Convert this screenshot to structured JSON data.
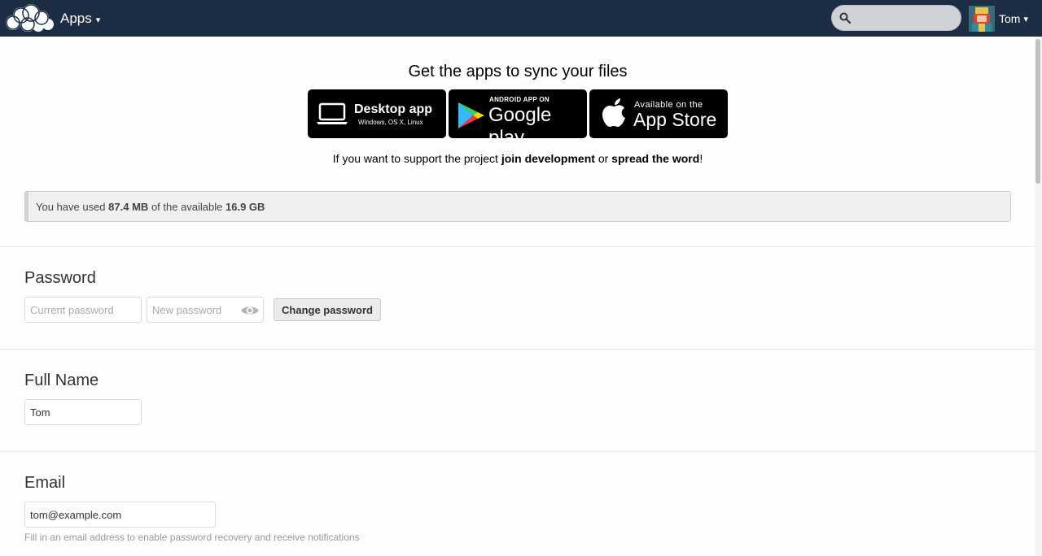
{
  "header": {
    "apps_label": "Apps",
    "apps_caret": "▾",
    "search": {
      "placeholder": "",
      "value": ""
    },
    "user_name": "Tom",
    "user_caret": "▾",
    "background_color": "#1d2d44"
  },
  "apps": {
    "title": "Get the apps to sync your files",
    "desktop": {
      "main": "Desktop app",
      "sub": "Windows, OS X, Linux"
    },
    "android": {
      "top": "ANDROID APP ON",
      "main": "Google play"
    },
    "ios": {
      "top": "Available on the",
      "main": "App Store"
    },
    "support": {
      "prefix": "If you want to support the project",
      "join_link": "join development",
      "middle": "or",
      "spread_link": "spread the word",
      "suffix": "!"
    }
  },
  "quota": {
    "prefix": "You have used",
    "used": "87.4 MB",
    "middle": "of the available",
    "total": "16.9 GB"
  },
  "password": {
    "title": "Password",
    "current_placeholder": "Current password",
    "new_placeholder": "New password",
    "button_label": "Change password"
  },
  "full_name": {
    "title": "Full Name",
    "value": "Tom"
  },
  "email": {
    "title": "Email",
    "value": "tom@example.com",
    "hint": "Fill in an email address to enable password recovery and receive notifications"
  }
}
